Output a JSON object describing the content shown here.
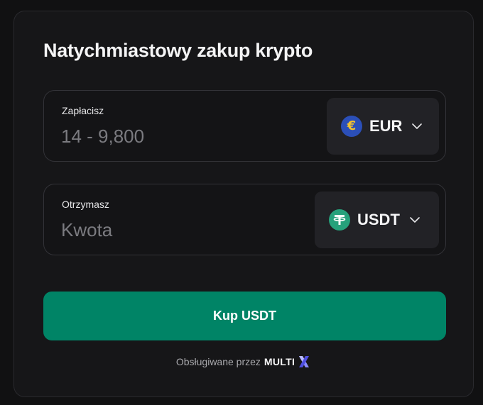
{
  "widget": {
    "title": "Natychmiastowy zakup krypto"
  },
  "pay": {
    "label": "Zapłacisz",
    "placeholder": "14 - 9,800",
    "value": "",
    "currency": {
      "code": "EUR",
      "icon": "euro-coin-icon",
      "icon_color": "#2b4fb8",
      "icon_symbol": "€",
      "icon_symbol_color": "#f2c230"
    }
  },
  "receive": {
    "label": "Otrzymasz",
    "placeholder": "Kwota",
    "value": "",
    "currency": {
      "code": "USDT",
      "icon": "tether-coin-icon",
      "icon_color": "#26a17b"
    }
  },
  "buy_button": {
    "label": "Kup USDT",
    "color": "#008466"
  },
  "footer": {
    "powered_by": "Obsługiwane przez",
    "brand": "MULTI",
    "brand_icon": "x-logo-icon",
    "brand_icon_color": "#6c6cf5"
  },
  "theme": {
    "background": "#111112",
    "card": "#161618",
    "selector": "#222226"
  }
}
